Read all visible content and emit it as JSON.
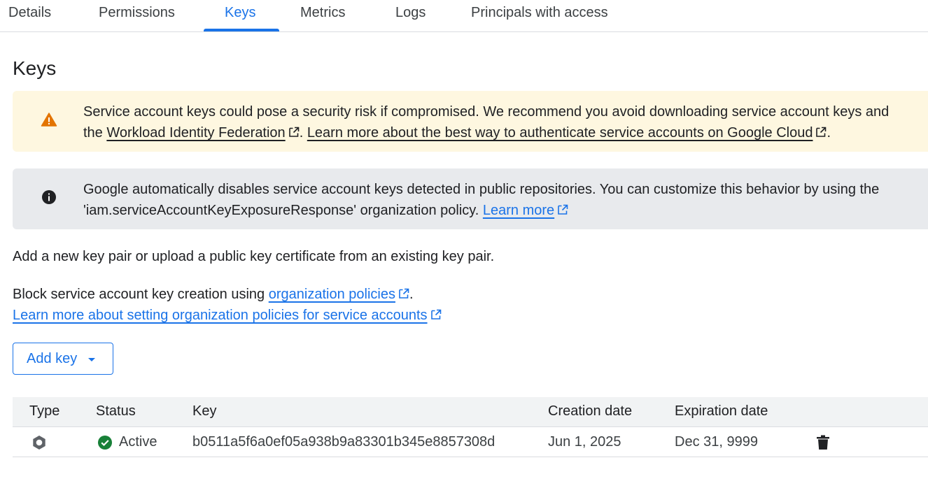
{
  "tabs": [
    {
      "label": "Details"
    },
    {
      "label": "Permissions"
    },
    {
      "label": "Keys"
    },
    {
      "label": "Metrics"
    },
    {
      "label": "Logs"
    },
    {
      "label": "Principals with access"
    }
  ],
  "active_tab": "Keys",
  "page_title": "Keys",
  "warning_banner": {
    "icon": "warning-icon",
    "line1": "Service account keys could pose a security risk if compromised. We recommend you avoid downloading service account keys and",
    "line2_prefix": "the ",
    "link1": "Workload Identity Federation",
    "separator": ". ",
    "link2": "Learn more about the best way to authenticate service accounts on Google Cloud",
    "suffix": "."
  },
  "info_banner": {
    "icon": "info-icon",
    "line1": "Google automatically disables service account keys detected in public repositories. You can customize this behavior by using the",
    "line2": "'iam.serviceAccountKeyExposureResponse' organization policy. ",
    "link": "Learn more"
  },
  "intro_text": "Add a new key pair or upload a public key certificate from an existing key pair.",
  "block_text": {
    "prefix": "Block service account key creation using ",
    "link": "organization policies",
    "suffix": "."
  },
  "learn_more_link": "Learn more about setting organization policies for service accounts",
  "add_key_button": "Add key",
  "table": {
    "headers": [
      "Type",
      "Status",
      "Key",
      "Creation date",
      "Expiration date"
    ],
    "rows": [
      {
        "type_icon": "service-account-key-icon",
        "status_icon": "check-circle-icon",
        "status": "Active",
        "key": "b0511a5f6a0ef05a938b9a83301b345e8857308d",
        "creation_date": "Jun 1, 2025",
        "expiration_date": "Dec 31, 9999",
        "action_icon": "delete-icon"
      }
    ]
  },
  "colors": {
    "accent": "#1a73e8",
    "warning_bg": "#fef7e0",
    "warning_icon": "#e37400",
    "info_bg": "#e8eaed",
    "success": "#188038"
  }
}
